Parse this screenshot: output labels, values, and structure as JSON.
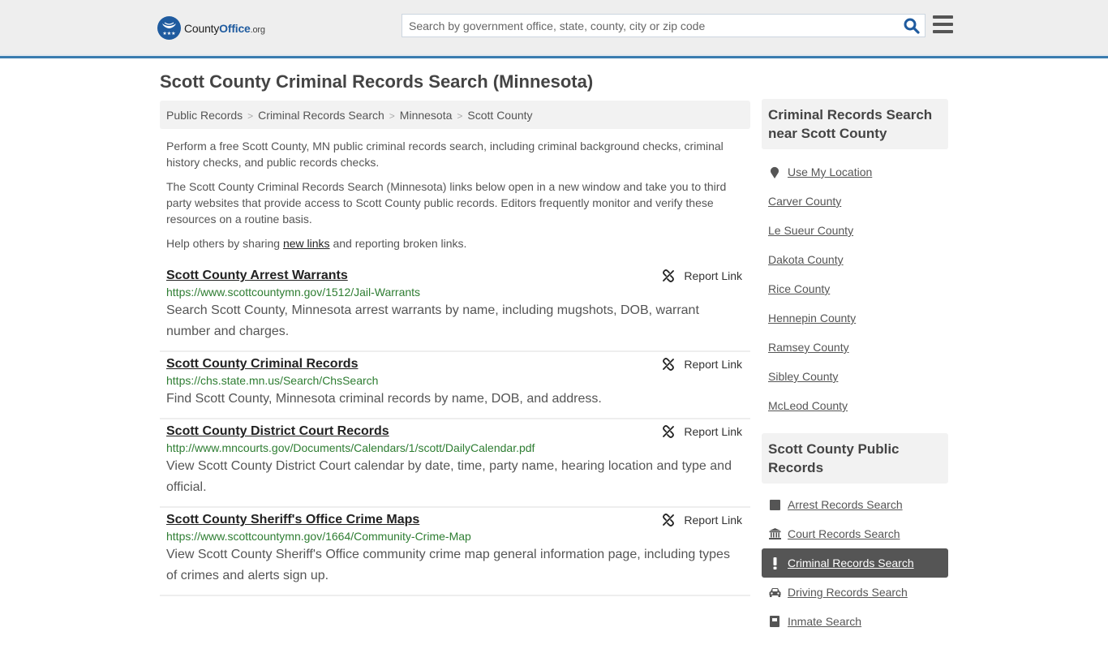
{
  "header": {
    "logo": {
      "county": "County",
      "office": "Office",
      "org": ".org"
    },
    "search_placeholder": "Search by government office, state, county, city or zip code",
    "brand_color": "#1f5b9f"
  },
  "page_title": "Scott County Criminal Records Search (Minnesota)",
  "breadcrumb": [
    "Public Records",
    "Criminal Records Search",
    "Minnesota",
    "Scott County"
  ],
  "intro": {
    "p1": "Perform a free Scott County, MN public criminal records search, including criminal background checks, criminal history checks, and public records checks.",
    "p2": "The Scott County Criminal Records Search (Minnesota) links below open in a new window and take you to third party websites that provide access to Scott County public records. Editors frequently monitor and verify these resources on a routine basis.",
    "p3_before": "Help others by sharing ",
    "p3_link": "new links",
    "p3_after": " and reporting broken links."
  },
  "report_label": "Report Link",
  "results": [
    {
      "title": "Scott County Arrest Warrants",
      "url": "https://www.scottcountymn.gov/1512/Jail-Warrants",
      "desc": "Search Scott County, Minnesota arrest warrants by name, including mugshots, DOB, warrant number and charges."
    },
    {
      "title": "Scott County Criminal Records",
      "url": "https://chs.state.mn.us/Search/ChsSearch",
      "desc": "Find Scott County, Minnesota criminal records by name, DOB, and address."
    },
    {
      "title": "Scott County District Court Records",
      "url": "http://www.mncourts.gov/Documents/Calendars/1/scott/DailyCalendar.pdf",
      "desc": "View Scott County District Court calendar by date, time, party name, hearing location and type and official."
    },
    {
      "title": "Scott County Sheriff's Office Crime Maps",
      "url": "https://www.scottcountymn.gov/1664/Community-Crime-Map",
      "desc": "View Scott County Sheriff's Office community crime map general information page, including types of crimes and alerts sign up."
    }
  ],
  "sidebar": {
    "nearby": {
      "heading": "Criminal Records Search near Scott County",
      "use_location": "Use My Location",
      "counties": [
        "Carver County",
        "Le Sueur County",
        "Dakota County",
        "Rice County",
        "Hennepin County",
        "Ramsey County",
        "Sibley County",
        "McLeod County"
      ]
    },
    "public_records": {
      "heading": "Scott County Public Records",
      "items": [
        {
          "label": "Arrest Records Search",
          "icon": "square-icon"
        },
        {
          "label": "Court Records Search",
          "icon": "courthouse-icon"
        },
        {
          "label": "Criminal Records Search",
          "icon": "exclamation-icon",
          "active": true
        },
        {
          "label": "Driving Records Search",
          "icon": "car-icon"
        },
        {
          "label": "Inmate Search",
          "icon": "inmate-icon"
        }
      ]
    }
  }
}
